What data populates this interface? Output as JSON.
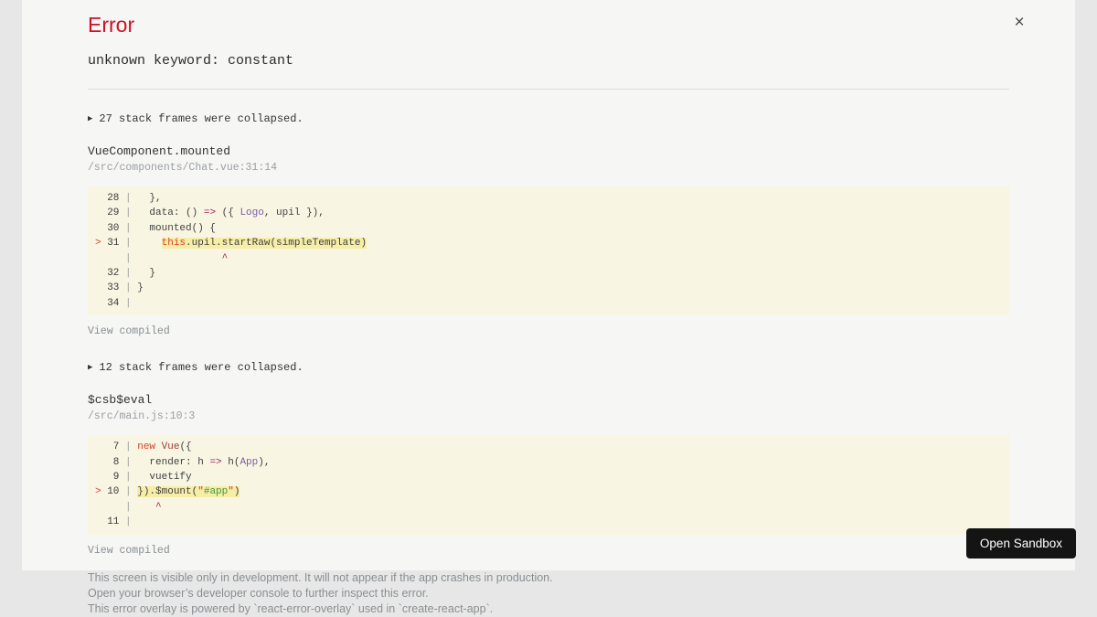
{
  "colors": {
    "title": "#ce1126",
    "plain": "#414141",
    "keyword": "#d6402c",
    "arrow": "#a71d5d",
    "cap": "#795da3",
    "ctor": "#9b4038",
    "quote": "#d6402c",
    "str": "#3f9b38",
    "caret": "#a71d5d",
    "marker": "#d6402c",
    "num": "#3a3a3a",
    "pipe": "#9e9e9e",
    "block_bg": "#f8f6e3",
    "highlight_bg": "#f6eda6"
  },
  "header": {
    "title": "Error",
    "message": "unknown keyword: constant",
    "close_icon": "×"
  },
  "marker_char": ">",
  "caret_char": "^",
  "collapse_icon": "▶",
  "sections": {
    "collapsed1": "27 stack frames were collapsed.",
    "frame1_function": "VueComponent.mounted",
    "frame1_location": "/src/components/Chat.vue:31:14",
    "view_compiled1": "View compiled",
    "collapsed2": "12 stack frames were collapsed.",
    "frame2_function": "$csb$eval",
    "frame2_location": "/src/main.js:10:3",
    "view_compiled2": "View compiled"
  },
  "code_blocks": [
    {
      "lines": [
        {
          "num": "28",
          "tokens": [
            [
              "  },",
              "plain"
            ]
          ]
        },
        {
          "num": "29",
          "tokens": [
            [
              "  data: () ",
              "plain"
            ],
            [
              "=>",
              "arrow"
            ],
            [
              " ({ ",
              "plain"
            ],
            [
              "Logo",
              "cap"
            ],
            [
              ", upil }),",
              "plain"
            ]
          ]
        },
        {
          "num": "30",
          "tokens": [
            [
              "  mounted() {",
              "plain"
            ]
          ]
        },
        {
          "num": "31",
          "marker": true,
          "tokens": [
            [
              "    ",
              "plain"
            ]
          ],
          "highlight": [
            [
              "this",
              "keyword"
            ],
            [
              ".upil.startRaw(simpleTemplate)",
              "plain"
            ]
          ]
        },
        {
          "caret": 14
        },
        {
          "num": "32",
          "tokens": [
            [
              "  }",
              "plain"
            ]
          ]
        },
        {
          "num": "33",
          "tokens": [
            [
              "}",
              "plain"
            ]
          ]
        },
        {
          "num": "34",
          "tokens": []
        }
      ]
    },
    {
      "lines": [
        {
          "num": "7",
          "tokens": [
            [
              "new",
              "keyword"
            ],
            [
              " ",
              "plain"
            ],
            [
              "Vue",
              "ctor"
            ],
            [
              "({",
              "plain"
            ]
          ]
        },
        {
          "num": "8",
          "tokens": [
            [
              "  render: h ",
              "plain"
            ],
            [
              "=>",
              "arrow"
            ],
            [
              " h(",
              "plain"
            ],
            [
              "App",
              "cap"
            ],
            [
              "),",
              "plain"
            ]
          ]
        },
        {
          "num": "9",
          "tokens": [
            [
              "  vuetify",
              "plain"
            ]
          ]
        },
        {
          "num": "10",
          "marker": true,
          "tokens": [],
          "highlight": [
            [
              "}).$mount(",
              "plain"
            ],
            [
              "\"",
              "quote"
            ],
            [
              "#app",
              "str"
            ],
            [
              "\"",
              "quote"
            ],
            [
              ")",
              "plain"
            ]
          ]
        },
        {
          "caret": 3
        },
        {
          "num": "11",
          "tokens": []
        }
      ]
    }
  ],
  "footer": {
    "lines": [
      "This screen is visible only in development. It will not appear if the app crashes in production.",
      "Open your browser’s developer console to further inspect this error.",
      "This error overlay is powered by `react-error-overlay` used in `create-react-app`."
    ]
  },
  "open_sandbox_label": "Open Sandbox"
}
